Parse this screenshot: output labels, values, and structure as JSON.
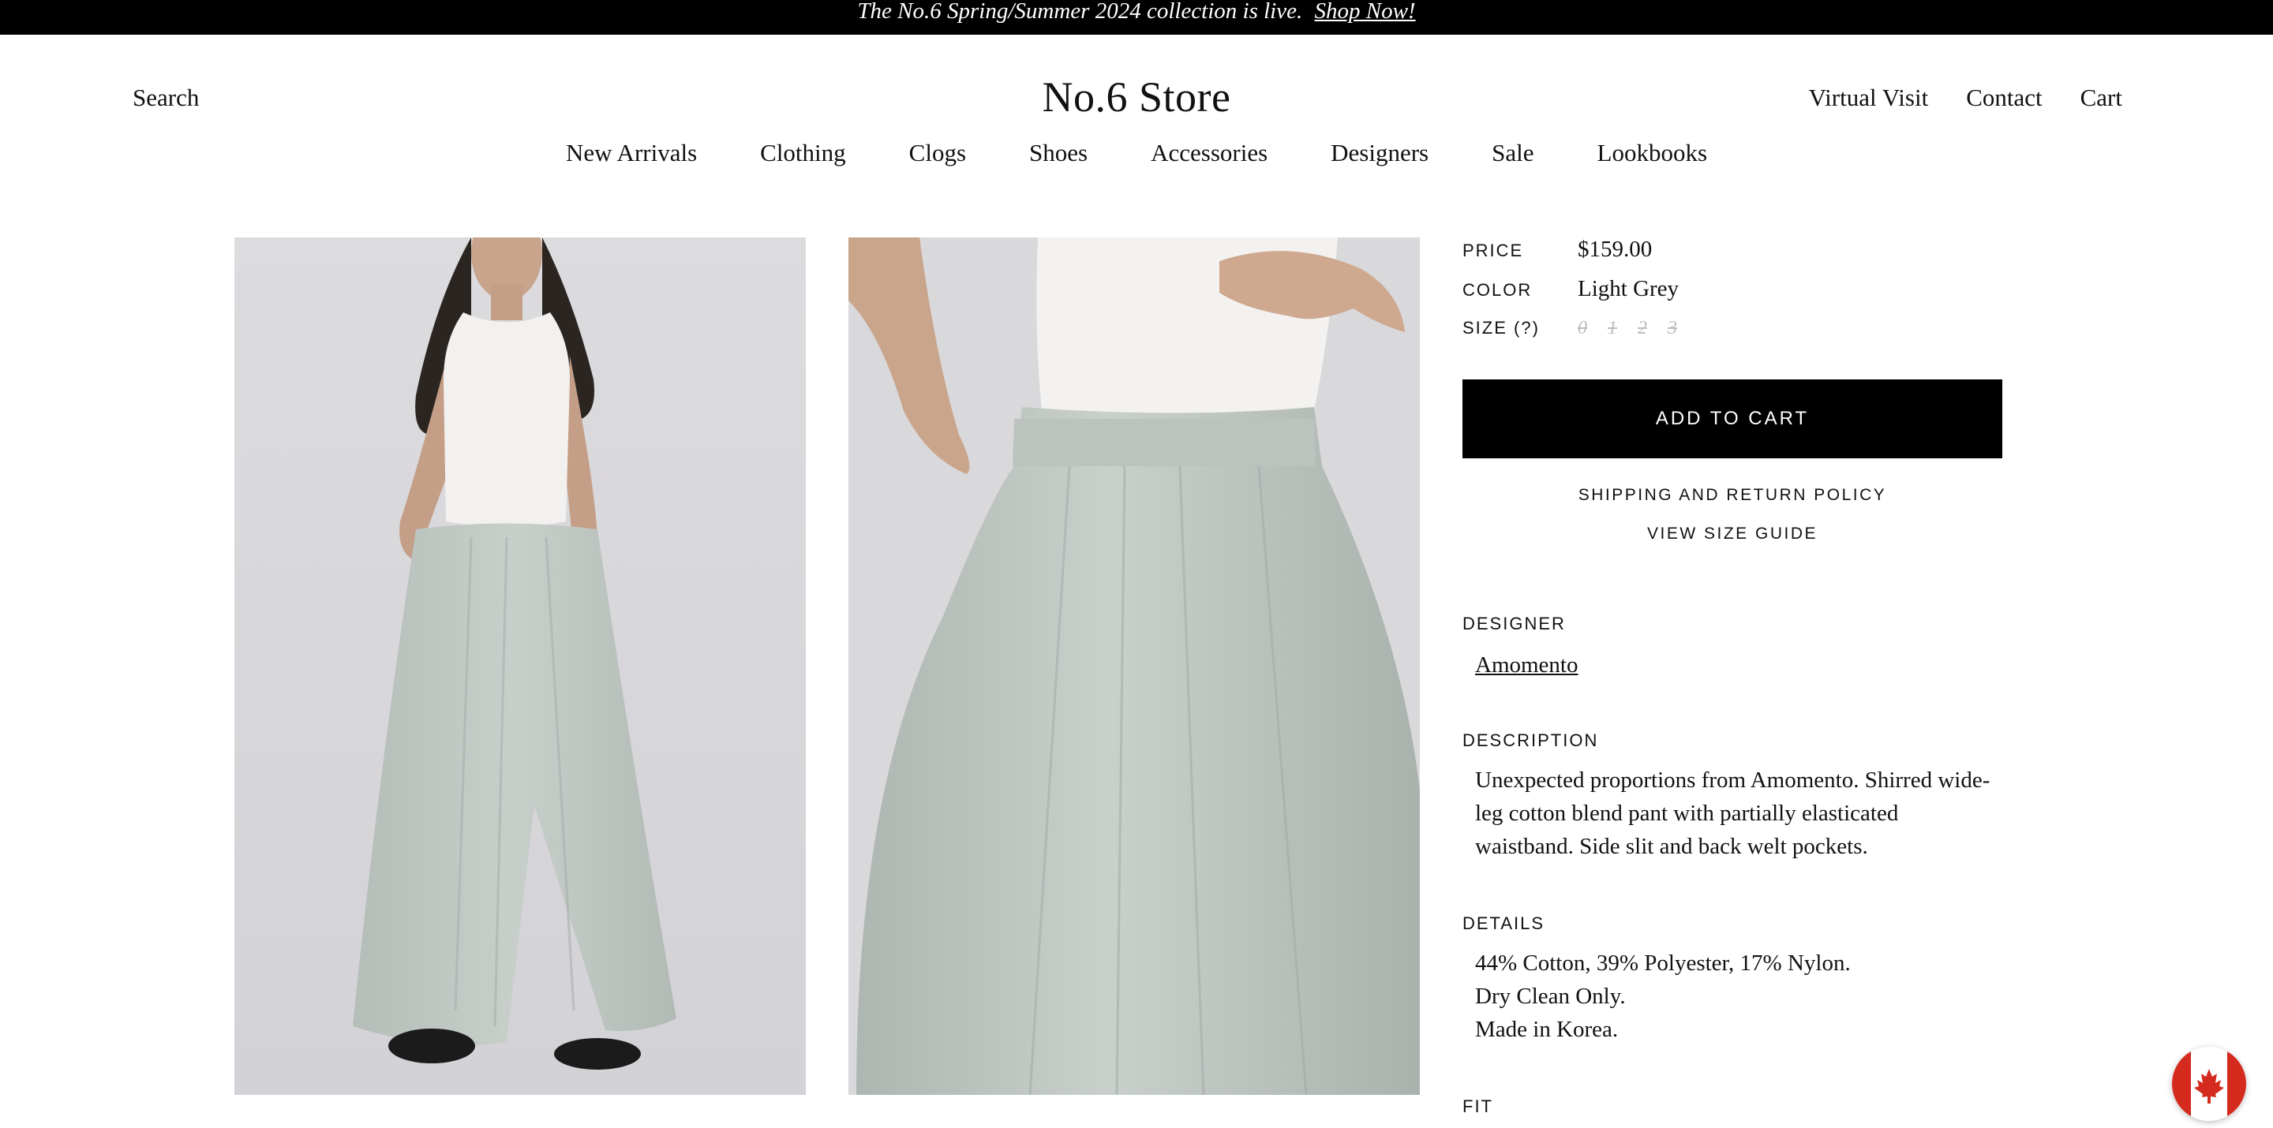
{
  "announcement": {
    "text": "The No.6 Spring/Summer 2024 collection is live.",
    "link": "Shop Now!"
  },
  "header": {
    "search_label": "Search",
    "logo": "No.6 Store",
    "utility_links": [
      "Virtual Visit",
      "Contact",
      "Cart"
    ]
  },
  "nav": {
    "items": [
      "New Arrivals",
      "Clothing",
      "Clogs",
      "Shoes",
      "Accessories",
      "Designers",
      "Sale",
      "Lookbooks"
    ]
  },
  "product": {
    "price_label": "PRICE",
    "price": "$159.00",
    "color_label": "COLOR",
    "color": "Light Grey",
    "size_label": "SIZE (?)",
    "sizes": [
      "0",
      "1",
      "2",
      "3"
    ],
    "add_to_cart": "ADD TO CART",
    "shipping_link": "SHIPPING AND RETURN POLICY",
    "size_guide_link": "VIEW SIZE GUIDE",
    "designer_label": "DESIGNER",
    "designer": "Amomento",
    "description_label": "DESCRIPTION",
    "description": "Unexpected proportions from Amomento. Shirred wide-leg cotton blend pant with partially elasticated waistband. Side slit and back welt pockets.",
    "details_label": "DETAILS",
    "details": [
      "44% Cotton, 39% Polyester, 17% Nylon.",
      "Dry Clean Only.",
      "Made in Korea."
    ],
    "fit_label": "FIT"
  },
  "colors": {
    "announcement_bg": "#000000",
    "button_bg": "#000000",
    "pant_color": "#c3cac6",
    "photo_bg": "#dad9dc",
    "flag_red": "#d52b1e"
  },
  "icons": {
    "country_flag": "canada-flag-icon"
  }
}
